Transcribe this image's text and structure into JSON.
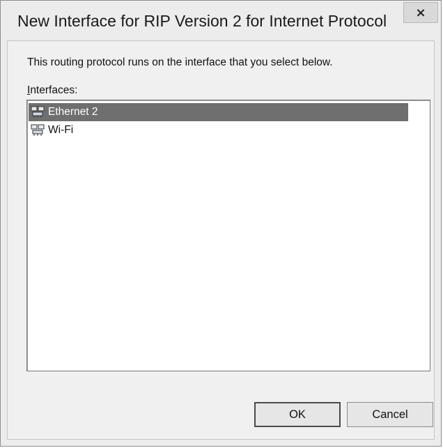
{
  "window": {
    "title": "New Interface for RIP Version 2 for Internet Protocol",
    "close_glyph": "×"
  },
  "description": "This routing protocol runs on the interface that you select below.",
  "interfaces": {
    "label_prefix": "I",
    "label_rest": "nterfaces:",
    "items": [
      {
        "label": "Ethernet 2",
        "icon": "network-adapter-icon",
        "selected": true
      },
      {
        "label": "Wi-Fi",
        "icon": "network-adapter-icon",
        "selected": false
      }
    ]
  },
  "buttons": {
    "ok": "OK",
    "cancel": "Cancel"
  },
  "colors": {
    "selection": "#6f6f6f",
    "window_bg": "#ececec"
  }
}
